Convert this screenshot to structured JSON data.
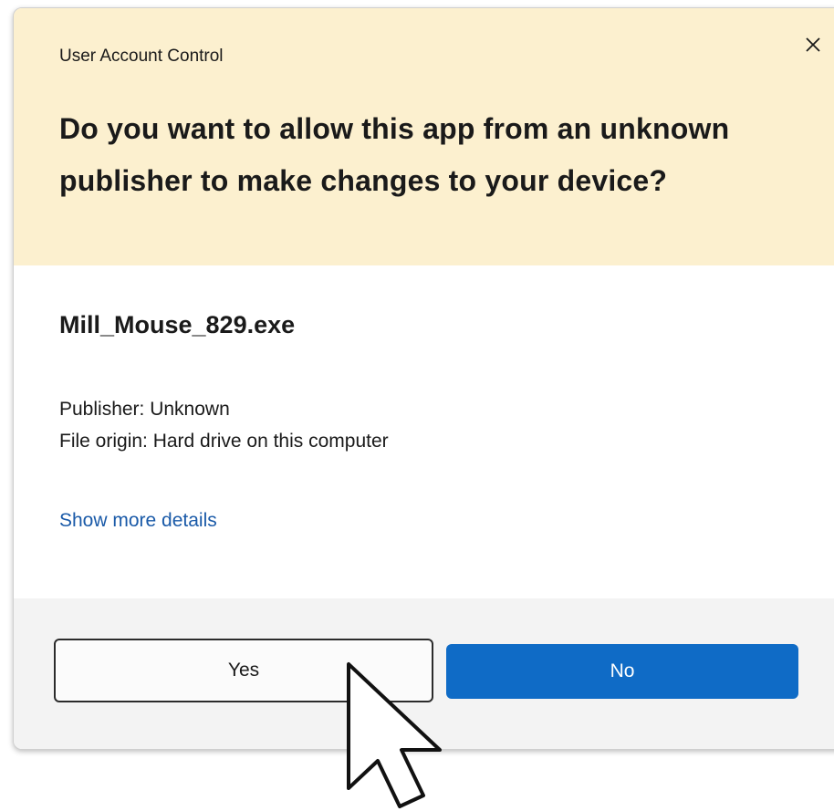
{
  "dialog": {
    "window_title": "User Account Control",
    "question": "Do you want to allow this app from an unknown publisher to make changes to your device?",
    "app_name": "Mill_Mouse_829.exe",
    "publisher": "Publisher: Unknown",
    "file_origin": "File origin: Hard drive on this computer",
    "details_link": "Show more details",
    "buttons": {
      "yes_label": "Yes",
      "no_label": "No"
    },
    "icons": {
      "close": "close-icon",
      "cursor": "mouse-pointer-icon"
    },
    "colors": {
      "header_bg": "#fcf0cf",
      "footer_bg": "#f3f3f3",
      "primary_button": "#0f6bc6",
      "link": "#1a5aa8"
    }
  }
}
